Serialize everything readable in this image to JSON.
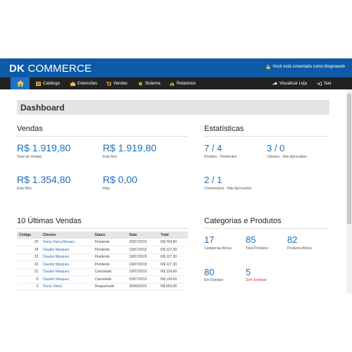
{
  "header": {
    "brand_bold": "DK",
    "brand_rest": "COMMERCE",
    "login_text": "Você está conectado como blognaweb"
  },
  "nav": {
    "items": [
      {
        "label": "Catálogo",
        "icon": "catalog-icon"
      },
      {
        "label": "Extensões",
        "icon": "puzzle-icon"
      },
      {
        "label": "Vendas",
        "icon": "cart-icon"
      },
      {
        "label": "Sistema",
        "icon": "gear-icon"
      },
      {
        "label": "Relatórios",
        "icon": "bar-chart-icon"
      }
    ],
    "view_store": "Visualizar Loja",
    "logout": "Sair"
  },
  "page": {
    "title": "Dashboard"
  },
  "vendas": {
    "title": "Vendas",
    "total_value": "R$ 1.919,80",
    "total_label": "Total de Vendas",
    "year_value": "R$ 1.919,80",
    "year_label": "Este Ano",
    "month_value": "R$ 1.354,80",
    "month_label": "Este Mês",
    "today_value": "R$ 0,00",
    "today_label": "Hoje"
  },
  "estatisticas": {
    "title": "Estatísticas",
    "orders_value": "7 / 4",
    "orders_label": "Pedidos - Pendentes",
    "clients_value": "3 / 0",
    "clients_label": "Clientes - Não Aprovados",
    "comments_value": "2 / 1",
    "comments_label": "Comentários - Não Aprovados"
  },
  "ultimas_vendas": {
    "title": "10 Últimas Vendas",
    "columns": [
      "Código",
      "Clientes",
      "Status",
      "Data",
      "Total"
    ],
    "rows": [
      [
        "25",
        "Tonny Vieira Moraes",
        "Pendente",
        "20/07/2015",
        "R$ 704,90"
      ],
      [
        "24",
        "Claudio Marques",
        "Pendente",
        "19/07/2015",
        "R$ 127,30"
      ],
      [
        "23",
        "Claudio Marques",
        "Pendente",
        "19/07/2015",
        "R$ 127,30"
      ],
      [
        "22",
        "Claudio Marques",
        "Pendente",
        "19/07/2015",
        "R$ 127,30"
      ],
      [
        "21",
        "Claudio Marques",
        "Cancelado",
        "19/07/2015",
        "R$ 134,00"
      ],
      [
        "6",
        "Claudio Marques",
        "Cancelado",
        "03/07/2015",
        "R$ 134,00"
      ],
      [
        "2",
        "Tonny Vieira",
        "Despachado",
        "20/06/2015",
        "R$ 565,00"
      ]
    ]
  },
  "categorias": {
    "title": "Categorias e Produtos",
    "active_cat_value": "17",
    "active_cat_label": "Categorias Ativas",
    "total_prod_value": "85",
    "total_prod_label": "Total Produtos",
    "active_prod_value": "82",
    "active_prod_label": "Produtos Ativos",
    "in_stock_value": "80",
    "in_stock_label": "Em Estoque",
    "no_stock_value": "5",
    "no_stock_label": "Sem Estoque"
  },
  "colors": {
    "brand_blue": "#0e5aa6",
    "nav_dark": "#222222",
    "active_blue": "#1e73c8",
    "value_blue": "#1f6fba",
    "warning_red": "#d0302a"
  }
}
